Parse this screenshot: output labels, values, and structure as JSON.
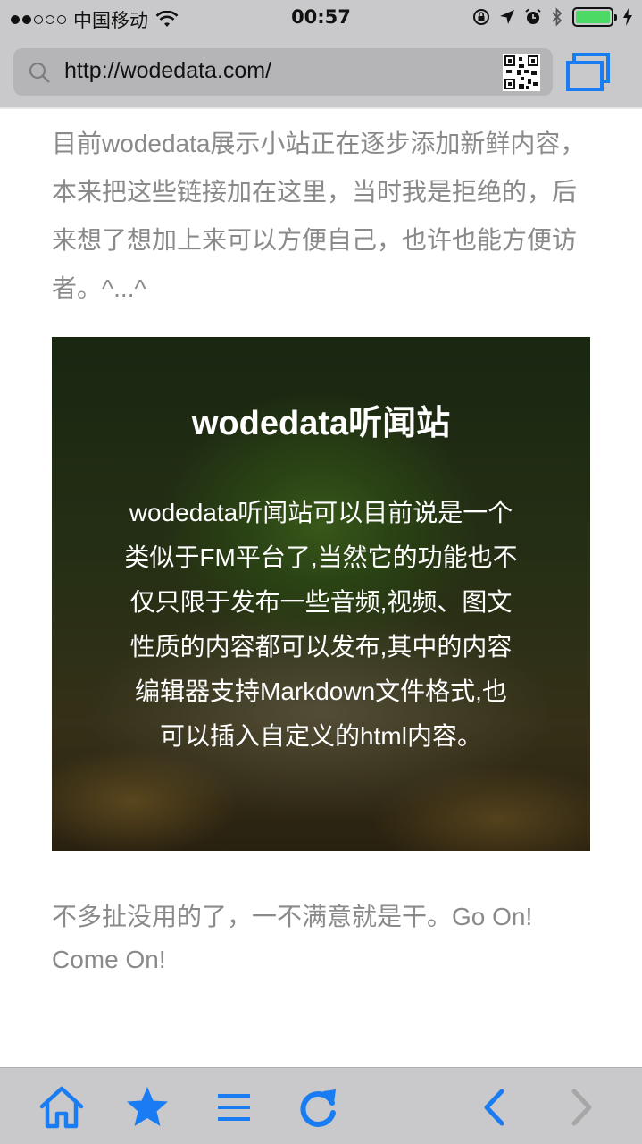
{
  "status_bar": {
    "carrier": "中国移动",
    "time": "00:57",
    "signal_bars_filled": 2,
    "signal_bars_total": 5,
    "battery_level": 1.0,
    "icons": [
      "wifi-icon",
      "orientation-lock-icon",
      "location-icon",
      "alarm-icon",
      "bluetooth-icon",
      "battery-icon",
      "charging-icon"
    ]
  },
  "address_bar": {
    "url": "http://wodedata.com/",
    "icons": [
      "search-icon",
      "qr-code-icon",
      "tabs-icon"
    ]
  },
  "content": {
    "intro_text": "目前wodedata展示小站正在逐步添加新鲜内容，本来把这些链接加在这里，当时我是拒绝的，后来想了想加上来可以方便自己，也许也能方便访者。^...^",
    "card": {
      "title": "wodedata听闻站",
      "lines": [
        "wodedata听闻站可以目前说是一个",
        "类似于FM平台了,当然它的功能也不",
        "仅只限于发布一些音频,视频、图文",
        "性质的内容都可以发布,其中的内容",
        "编辑器支持Markdown文件格式,也",
        "可以插入自定义的html内容。"
      ]
    },
    "outro_text": "不多扯没用的了，一不满意就是干。Go On! Come On!"
  },
  "toolbar": {
    "icons": [
      "home-icon",
      "star-icon",
      "menu-icon",
      "refresh-icon",
      "back-icon",
      "forward-icon"
    ]
  },
  "colors": {
    "accent": "#1a7cf2",
    "chrome_bg": "#c9c9cb",
    "body_text": "#8a8a8a",
    "disabled": "#a6a6a6"
  }
}
